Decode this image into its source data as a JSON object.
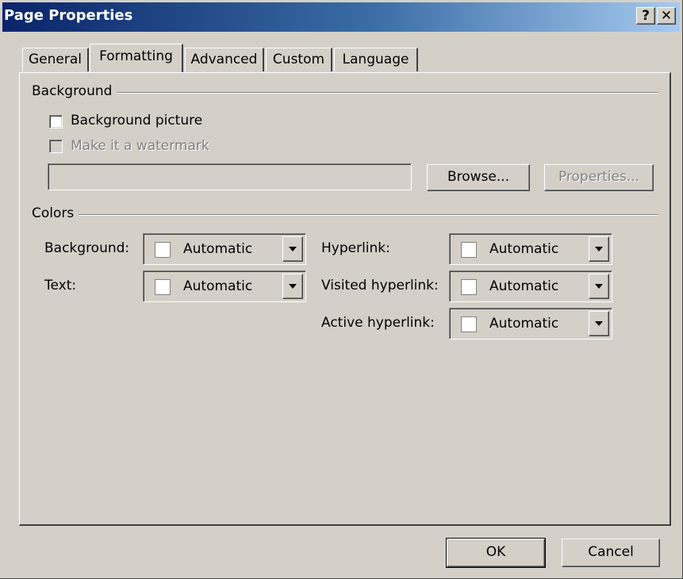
{
  "window": {
    "title": "Page Properties",
    "help_glyph": "?",
    "close_glyph": "✕"
  },
  "tabs": [
    {
      "label": "General",
      "active": false
    },
    {
      "label": "Formatting",
      "active": true
    },
    {
      "label": "Advanced",
      "active": false
    },
    {
      "label": "Custom",
      "active": false
    },
    {
      "label": "Language",
      "active": false
    }
  ],
  "background": {
    "group_label": "Background",
    "picture_label": "Background picture",
    "picture_checked": false,
    "watermark_label": "Make it a watermark",
    "watermark_checked": false,
    "watermark_enabled": false,
    "path_value": "",
    "browse_label": "Browse...",
    "properties_label": "Properties..."
  },
  "colors": {
    "group_label": "Colors",
    "background_label": "Background:",
    "background_value": "Automatic",
    "text_label": "Text:",
    "text_value": "Automatic",
    "hyperlink_label": "Hyperlink:",
    "hyperlink_value": "Automatic",
    "visited_label": "Visited hyperlink:",
    "visited_value": "Automatic",
    "active_label": "Active hyperlink:",
    "active_value": "Automatic"
  },
  "footer": {
    "ok_label": "OK",
    "cancel_label": "Cancel"
  },
  "palette": {
    "titlebar_start": "#0a246a",
    "titlebar_end": "#a6caf0",
    "face": "#d4d0c8"
  },
  "icons": {
    "help": "help-icon",
    "close": "close-icon",
    "dropdown": "chevron-down-icon"
  }
}
